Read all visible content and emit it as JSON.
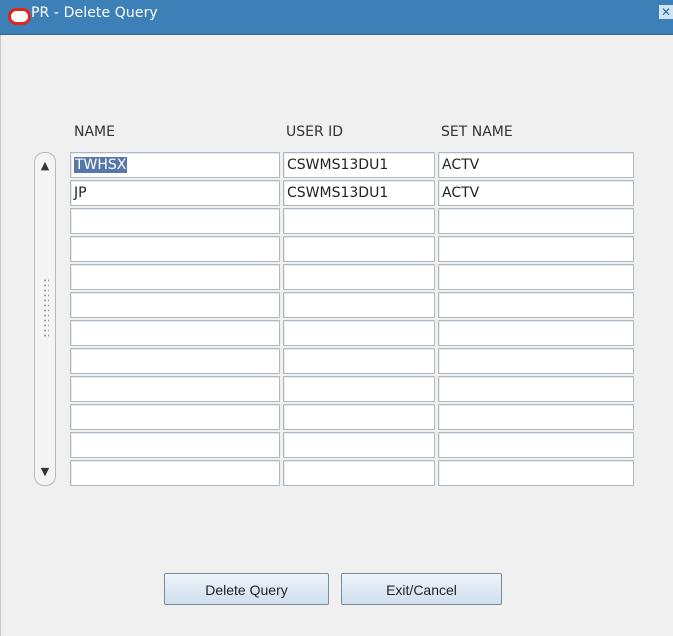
{
  "window": {
    "title": "PR - Delete Query",
    "close_glyph": "✕"
  },
  "grid": {
    "headers": [
      "NAME",
      "USER ID",
      "SET NAME"
    ],
    "rows": [
      [
        "TWHSX",
        "CSWMS13DU1",
        "ACTV"
      ],
      [
        "JP",
        "CSWMS13DU1",
        "ACTV"
      ],
      [
        "",
        "",
        ""
      ],
      [
        "",
        "",
        ""
      ],
      [
        "",
        "",
        ""
      ],
      [
        "",
        "",
        ""
      ],
      [
        "",
        "",
        ""
      ],
      [
        "",
        "",
        ""
      ],
      [
        "",
        "",
        ""
      ],
      [
        "",
        "",
        ""
      ],
      [
        "",
        "",
        ""
      ],
      [
        "",
        "",
        ""
      ]
    ],
    "selected_row": 0
  },
  "buttons": {
    "delete_label": "Delete Query",
    "exit_label": "Exit/Cancel"
  },
  "icons": {
    "logo": "oracle-logo-icon",
    "close": "close-icon",
    "scroll_up": "scroll-up-icon",
    "scroll_down": "scroll-down-icon"
  },
  "colors": {
    "titlebar": "#3d80b7",
    "selection": "#5577aa",
    "logo": "#e0251b"
  }
}
